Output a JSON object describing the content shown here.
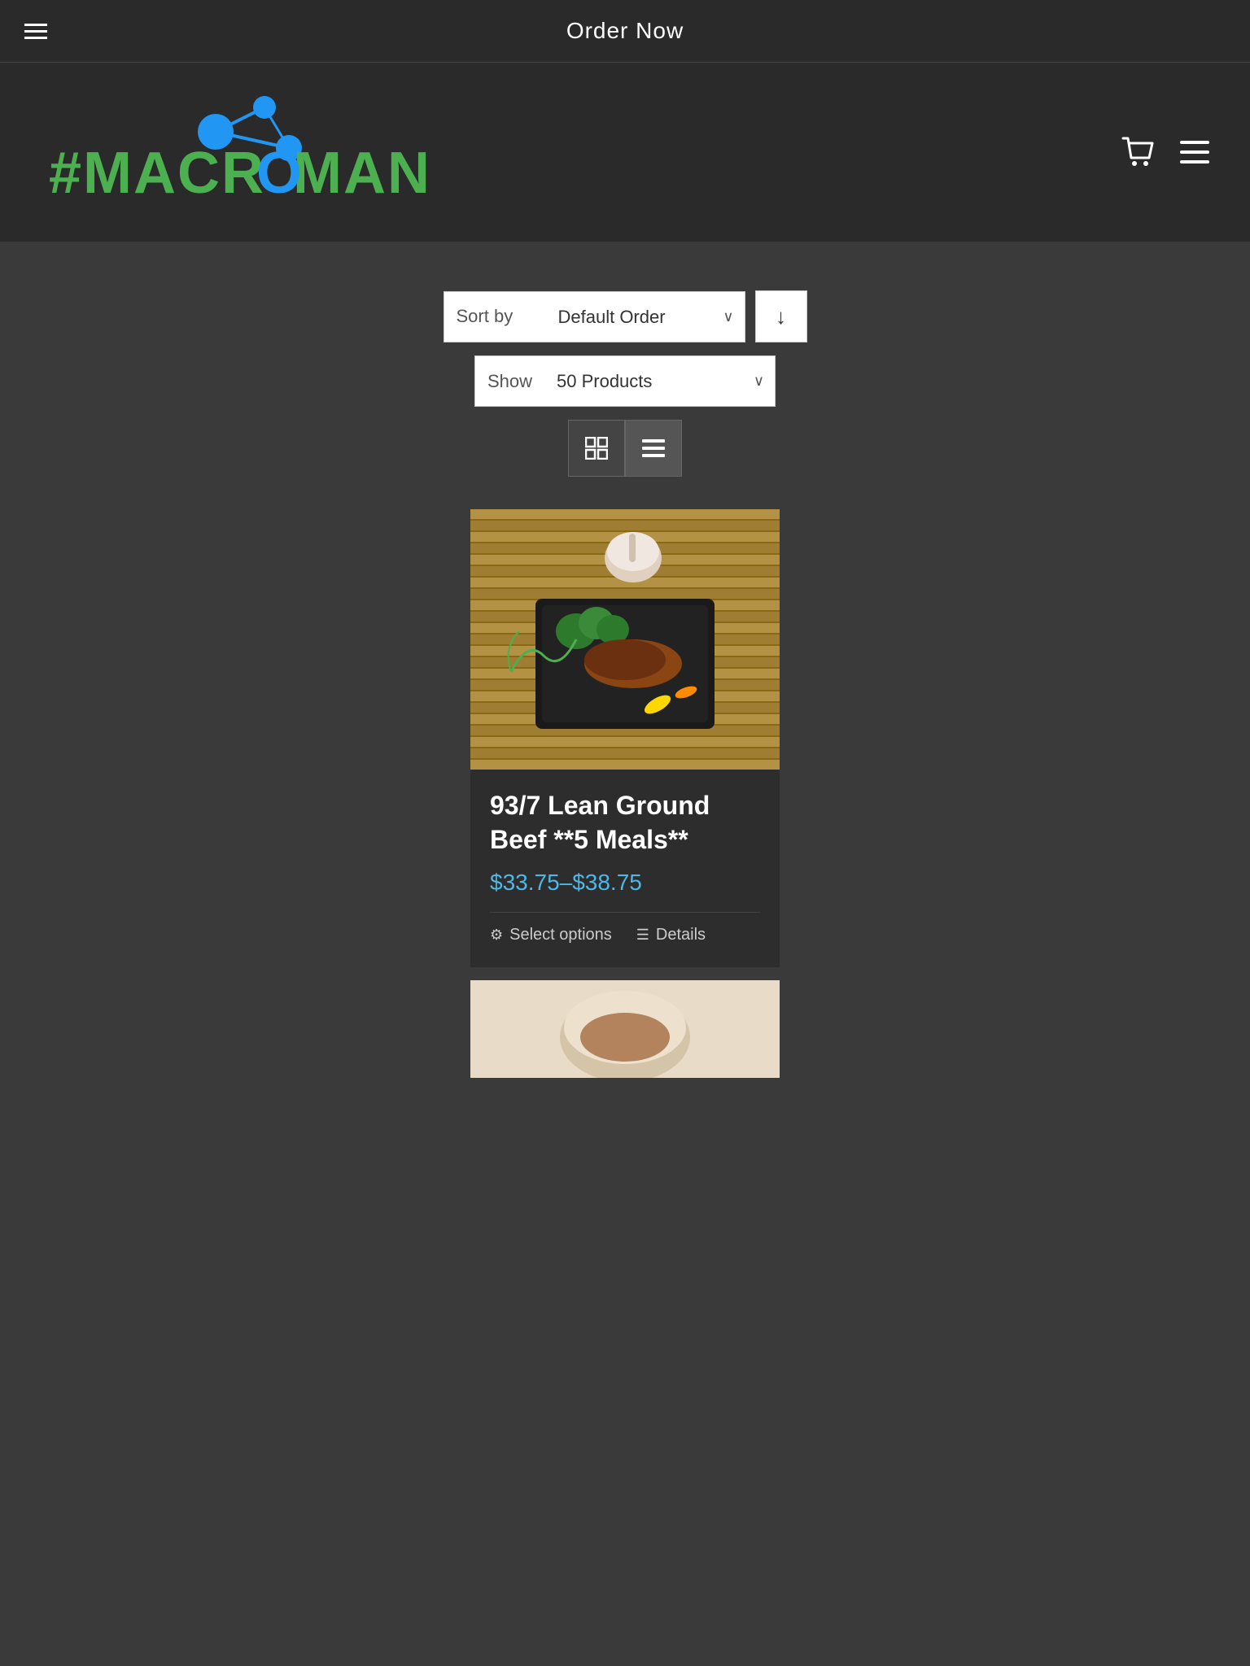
{
  "topbar": {
    "menu_label": "Order Now",
    "hamburger_icon": "☰"
  },
  "header": {
    "logo_text": "#MACROMAN",
    "cart_icon": "🛒",
    "menu_icon": "☰"
  },
  "filters": {
    "sort_label": "Sort by",
    "sort_value": "Default Order",
    "sort_direction_icon": "↓",
    "show_label": "Show",
    "show_value": "50 Products",
    "show_full": "Show 50 Products",
    "grid_view_icon": "⊞",
    "list_view_icon": "≡"
  },
  "products": [
    {
      "title": "93/7 Lean Ground Beef **5 Meals**",
      "price_range": "$33.75–$38.75",
      "price_low": "$33.75",
      "price_high": "$38.75",
      "select_options_label": "Select options",
      "details_label": "Details"
    }
  ],
  "colors": {
    "background": "#3a3a3a",
    "header_bg": "#2a2a2a",
    "card_bg": "#2d2d2d",
    "accent_blue": "#4db8e8",
    "text_white": "#ffffff",
    "text_light": "#cccccc"
  }
}
